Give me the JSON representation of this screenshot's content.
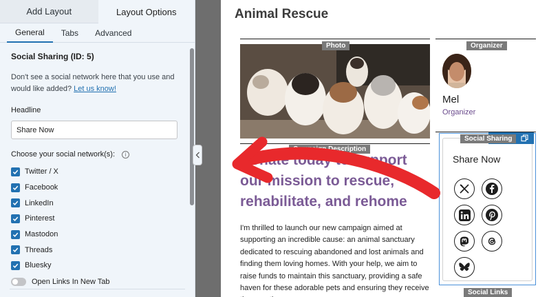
{
  "panel": {
    "top_tabs": [
      "Add Layout",
      "Layout Options"
    ],
    "sub_tabs": [
      "General",
      "Tabs",
      "Advanced"
    ],
    "section_title": "Social Sharing (ID: 5)",
    "help_text": "Don't see a social network here that you use and would like added?",
    "help_link": "Let us know!",
    "headline_label": "Headline",
    "headline_value": "Share Now",
    "networks_label": "Choose your social network(s):",
    "networks": [
      "Twitter / X",
      "Facebook",
      "LinkedIn",
      "Pinterest",
      "Mastodon",
      "Threads",
      "Bluesky"
    ],
    "open_links_label": "Open Links In New Tab"
  },
  "preview": {
    "page_title": "Animal Rescue",
    "photo_tag": "Photo",
    "organizer_tag": "Organizer",
    "organizer_name": "Mel",
    "organizer_role": "Organizer",
    "description_tag": "Campaign Description",
    "campaign_headline": "Donate today to support our mission to rescue, rehabilitate, and rehome",
    "campaign_body": "I'm thrilled to launch our new campaign aimed at supporting an incredible cause: an animal sanctuary dedicated to rescuing abandoned and lost animals and finding them loving homes. With your help, we aim to raise funds to maintain this sanctuary, providing a safe haven for these adorable pets and ensuring they receive the care they",
    "social_tag": "Social Sharing",
    "social_headline": "Share Now",
    "social_links_tag": "Social Links",
    "social_icons": [
      "x-icon",
      "facebook-icon",
      "linkedin-icon",
      "pinterest-icon",
      "mastodon-icon",
      "threads-icon",
      "bluesky-icon"
    ]
  },
  "colors": {
    "accent": "#2271b1",
    "headline_purple": "#7b5b96",
    "arrow_red": "#e8292c"
  }
}
